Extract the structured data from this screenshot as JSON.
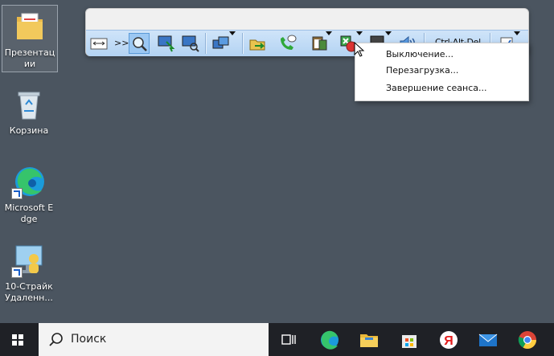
{
  "desktop": {
    "icons": [
      {
        "label": "Презентации",
        "icon": "folder-pdf-icon"
      },
      {
        "label": "Корзина",
        "icon": "recycle-bin-icon"
      },
      {
        "label": "Microsoft Edge",
        "icon": "edge-icon"
      },
      {
        "label": "10-Страйк Удаленн...",
        "icon": "remote-desktop-icon"
      }
    ]
  },
  "remote_toolbar": {
    "overflow_label": ">>",
    "ctrl_alt_del_label": "Ctrl-Alt-Del",
    "buttons": [
      "fit-screen-icon",
      "zoom-icon",
      "screen-select-icon",
      "screen-zoom-icon",
      "monitors-icon",
      "file-transfer-icon",
      "chat-call-icon",
      "clipboard-icon",
      "power-icon",
      "lock-screen-icon",
      "volume-icon",
      "settings-icon"
    ]
  },
  "power_menu": {
    "items": [
      "Выключение...",
      "Перезагрузка...",
      "Завершение сеанса..."
    ]
  },
  "taskbar": {
    "search_placeholder": "Поиск",
    "apps": [
      "task-view-icon",
      "edge-icon",
      "file-explorer-icon",
      "store-icon",
      "yandex-icon",
      "mail-icon",
      "chrome-icon"
    ]
  }
}
